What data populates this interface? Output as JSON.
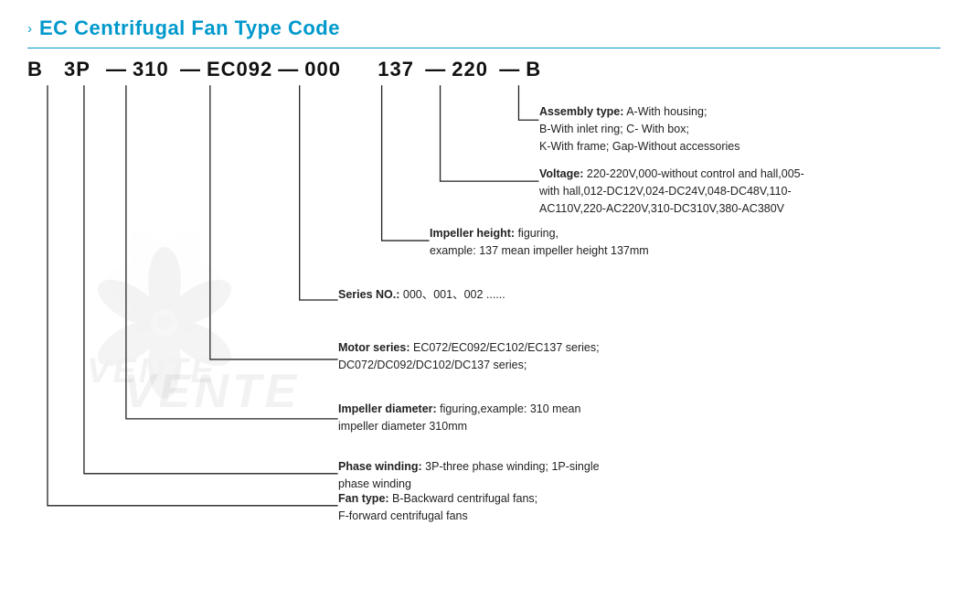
{
  "title": {
    "chevron": "›",
    "text": "EC Centrifugal Fan Type Code"
  },
  "code": {
    "parts": [
      "B",
      "3P",
      "310",
      "EC092",
      "000",
      "137",
      "220",
      "B"
    ],
    "dashes": [
      "—",
      "—",
      "—",
      "—",
      "—",
      "—"
    ]
  },
  "descriptions": {
    "assembly": {
      "label": "Assembly type:",
      "text": "A-With housing;\nB-With inlet ring;  C- With box;\nK-With frame; Gap-Without accessories"
    },
    "voltage": {
      "label": "Voltage:",
      "text": "220-220V,000-without control and hall,005-with hall,012-DC12V,024-DC24V,048-DC48V,110-AC110V,220-AC220V,310-DC310V,380-AC380V"
    },
    "impeller_height": {
      "label": "Impeller height:",
      "text": "figuring,\nexample: 137 mean impeller height 137mm"
    },
    "series": {
      "label": "Series NO.:",
      "text": "000、001、002 ......"
    },
    "motor": {
      "label": "Motor series:",
      "text": "EC072/EC092/EC102/EC137 series;\nDC072/DC092/DC102/DC137 series;"
    },
    "impeller_dia": {
      "label": "Impeller diameter:",
      "text": "figuring,example: 310 mean\nimpeller diameter 310mm"
    },
    "phase": {
      "label": "Phase winding:",
      "text": "3P-three phase winding;  1P-single\nphase winding"
    },
    "fan_type": {
      "label": "Fan type:",
      "text": "B-Backward centrifugal fans;\nF-forward centrifugal fans"
    }
  },
  "watermark_text": "VENTE"
}
